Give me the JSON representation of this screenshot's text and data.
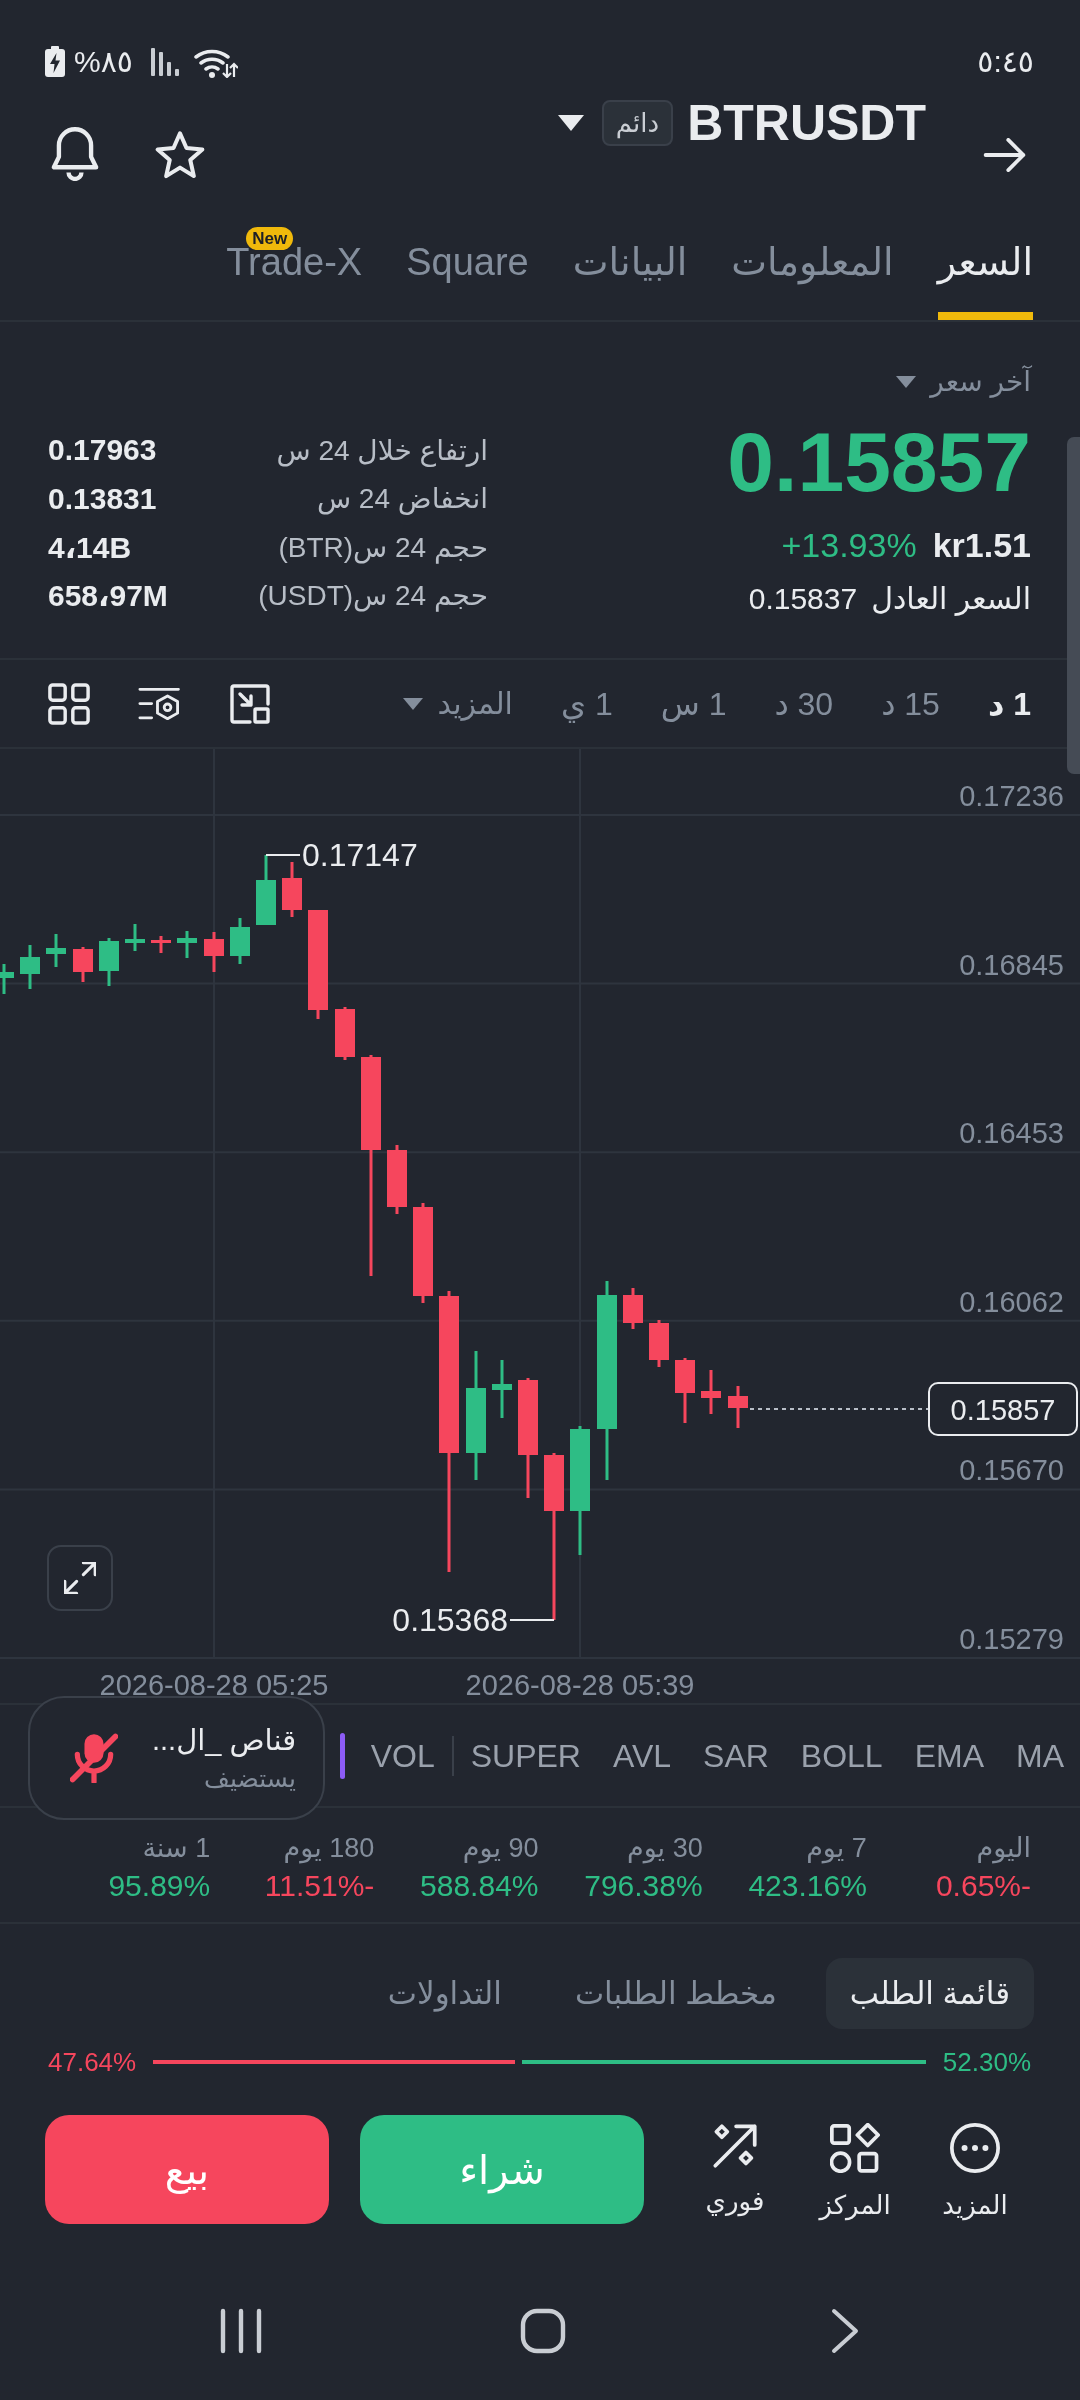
{
  "status_bar": {
    "battery": "%٨٥",
    "time": "٥:٤٥"
  },
  "header": {
    "symbol": "BTRUSDT",
    "badge": "دائم"
  },
  "tabs": [
    {
      "label": "السعر",
      "selected": true
    },
    {
      "label": "المعلومات",
      "selected": false
    },
    {
      "label": "البيانات",
      "selected": false
    },
    {
      "label": "Square",
      "selected": false
    },
    {
      "label": "Trade-X",
      "selected": false,
      "badge": "New"
    }
  ],
  "price": {
    "type_label": "آخر سعر",
    "last": "0.15857",
    "negative": false,
    "change": "+13.93%",
    "local": "kr1.51",
    "fair_label": "السعر العادل",
    "fair": "0.15837"
  },
  "stats": [
    {
      "label": "ارتفاع خلال 24 س",
      "value": "0.17963"
    },
    {
      "label": "انخفاض 24 س",
      "value": "0.13831"
    },
    {
      "label": "حجم 24 س(BTR)",
      "value": "4،14B"
    },
    {
      "label": "حجم 24 س(USDT)",
      "value": "658،97M"
    }
  ],
  "intervals": [
    {
      "label": "1 د",
      "selected": true
    },
    {
      "label": "15 د",
      "selected": false
    },
    {
      "label": "30 د",
      "selected": false
    },
    {
      "label": "1 س",
      "selected": false
    },
    {
      "label": "1 ي",
      "selected": false
    }
  ],
  "more_intervals": {
    "label": "المزيد"
  },
  "chart": {
    "price_labels": [
      "0.17236",
      "0.16845",
      "0.16453",
      "0.16062",
      "0.15670",
      "0.15279"
    ],
    "current_price": "0.15857",
    "high": "0.17147",
    "low": "0.15368",
    "times": [
      "2026-08-28 05:39",
      "2026-08-28 05:25"
    ]
  },
  "indicators": {
    "main": [
      "MA",
      "EMA",
      "BOLL",
      "SAR",
      "AVL",
      "SUPER"
    ],
    "sub": [
      "VOL"
    ]
  },
  "live_room": {
    "title": "قناص _ال...",
    "subtitle": "يستضيف",
    "muted": true
  },
  "performance": [
    {
      "period": "اليوم",
      "change": "0.65%-",
      "negative": true
    },
    {
      "period": "7 يوم",
      "change": "423.16%",
      "negative": false
    },
    {
      "period": "30 يوم",
      "change": "796.38%",
      "negative": false
    },
    {
      "period": "90 يوم",
      "change": "588.84%",
      "negative": false
    },
    {
      "period": "180 يوم",
      "change": "11.51%-",
      "negative": true
    },
    {
      "period": "1 سنة",
      "change": "95.89%",
      "negative": false
    }
  ],
  "book_tabs": [
    {
      "label": "قائمة الطلب",
      "selected": true
    },
    {
      "label": "مخطط الطلبات",
      "selected": false
    },
    {
      "label": "التداولات",
      "selected": false
    }
  ],
  "book_ratio": {
    "buy": "52.30%",
    "sell": "47.64%",
    "level": 0.523
  },
  "shortcuts": [
    {
      "label": "المزيد",
      "kind": "more"
    },
    {
      "label": "المركز",
      "kind": "positions"
    },
    {
      "label": "فوري",
      "kind": "instant"
    }
  ],
  "trade_buttons": [
    {
      "label": "شراء",
      "kind": "buy"
    },
    {
      "label": "بيع",
      "kind": "sell"
    }
  ]
}
